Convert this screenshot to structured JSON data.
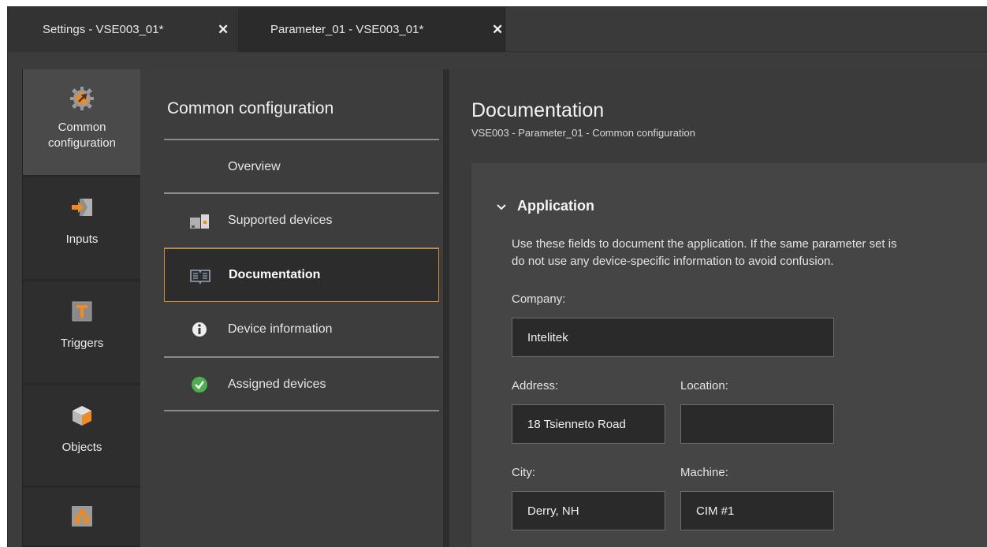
{
  "tabs": [
    {
      "label": "Settings - VSE003_01*",
      "close": "✕"
    },
    {
      "label": "Parameter_01 - VSE003_01*",
      "close": "✕"
    }
  ],
  "rail": {
    "items": [
      {
        "label_line1": "Common",
        "label_line2": "configuration",
        "icon": "gear-wrench-icon"
      },
      {
        "label": "Inputs",
        "icon": "input-arrow-icon"
      },
      {
        "label": "Triggers",
        "icon": "trigger-t-icon"
      },
      {
        "label": "Objects",
        "icon": "cube-icon"
      },
      {
        "label": "",
        "icon": "network-icon"
      }
    ]
  },
  "nav": {
    "title": "Common configuration",
    "items": [
      {
        "label": "Overview"
      },
      {
        "label": "Supported devices",
        "icon": "devices-icon"
      },
      {
        "label": "Documentation",
        "icon": "book-icon"
      },
      {
        "label": "Device information",
        "icon": "info-icon"
      },
      {
        "label": "Assigned devices",
        "icon": "check-circle-icon"
      }
    ]
  },
  "content": {
    "title": "Documentation",
    "subtitle": "VSE003 - Parameter_01 - Common configuration",
    "section": {
      "title": "Application",
      "description_line1": "Use these fields to document the application. If the same parameter set is",
      "description_line2": "do not use any device-specific information to avoid confusion."
    },
    "fields": {
      "company": {
        "label": "Company:",
        "value": "Intelitek"
      },
      "address": {
        "label": "Address:",
        "value": "18 Tsienneto Road"
      },
      "location": {
        "label": "Location:",
        "value": ""
      },
      "city": {
        "label": "City:",
        "value": "Derry, NH"
      },
      "machine": {
        "label": "Machine:",
        "value": "CIM #1"
      }
    }
  },
  "colors": {
    "accent": "#d4892a",
    "icon_orange": "#f08a24",
    "check_green": "#4caf50"
  }
}
